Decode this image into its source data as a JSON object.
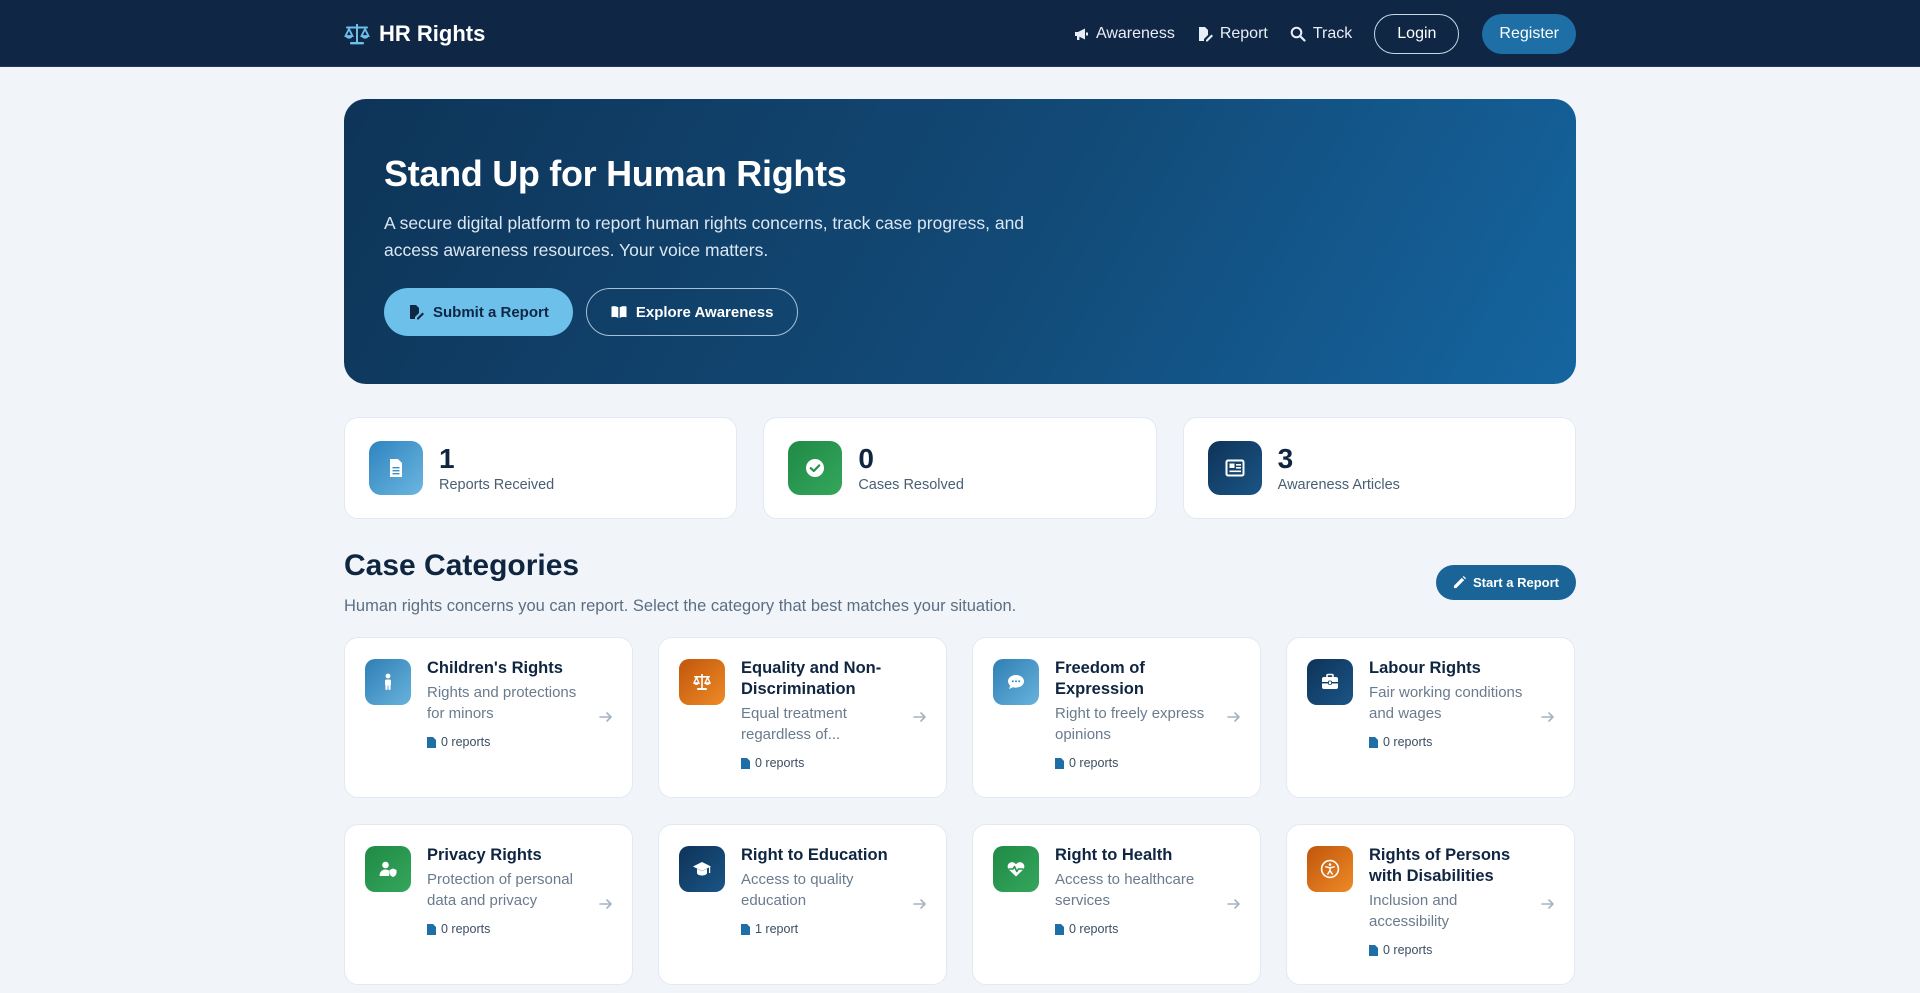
{
  "nav": {
    "brand": "HR Rights",
    "links": [
      "Awareness",
      "Report",
      "Track"
    ],
    "login": "Login",
    "register": "Register"
  },
  "hero": {
    "title": "Stand Up for Human Rights",
    "subtitle": "A secure digital platform to report human rights concerns, track case progress, and access awareness resources. Your voice matters.",
    "primary_button": "Submit a Report",
    "secondary_button": "Explore Awareness"
  },
  "stats": [
    {
      "value": "1",
      "label": "Reports Received",
      "icon": "document-icon",
      "color": "#3a8fc6"
    },
    {
      "value": "0",
      "label": "Cases Resolved",
      "icon": "check-circle-icon",
      "color": "#26914c"
    },
    {
      "value": "3",
      "label": "Awareness Articles",
      "icon": "newspaper-icon",
      "color": "#0f3a62"
    }
  ],
  "section": {
    "title": "Case Categories",
    "subtitle": "Human rights concerns you can report. Select the category that best matches your situation.",
    "start_button": "Start a Report"
  },
  "categories": [
    {
      "title": "Children's Rights",
      "desc": "Rights and protections for minors",
      "count": "0 reports",
      "icon": "child-icon",
      "color": "#3a8fc6"
    },
    {
      "title": "Equality and Non-Discrimination",
      "desc": "Equal treatment regardless of...",
      "count": "0 reports",
      "icon": "scales-icon",
      "color": "#d96c18"
    },
    {
      "title": "Freedom of Expression",
      "desc": "Right to freely express opinions",
      "count": "0 reports",
      "icon": "speech-bubble-icon",
      "color": "#3a8fc6"
    },
    {
      "title": "Labour Rights",
      "desc": "Fair working conditions and wages",
      "count": "0 reports",
      "icon": "briefcase-icon",
      "color": "#0f3a62"
    },
    {
      "title": "Privacy Rights",
      "desc": "Protection of personal data and privacy",
      "count": "0 reports",
      "icon": "user-shield-icon",
      "color": "#26914c"
    },
    {
      "title": "Right to Education",
      "desc": "Access to quality education",
      "count": "1 report",
      "icon": "graduation-cap-icon",
      "color": "#0f3a62"
    },
    {
      "title": "Right to Health",
      "desc": "Access to healthcare services",
      "count": "0 reports",
      "icon": "heart-pulse-icon",
      "color": "#26914c"
    },
    {
      "title": "Rights of Persons with Disabilities",
      "desc": "Inclusion and accessibility",
      "count": "0 reports",
      "icon": "accessibility-icon",
      "color": "#d96c18"
    }
  ]
}
